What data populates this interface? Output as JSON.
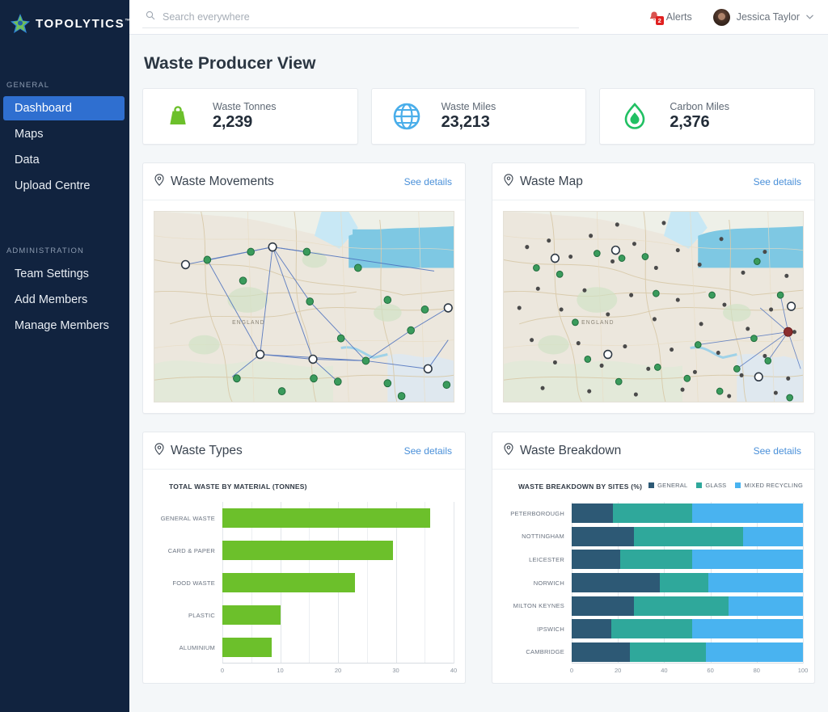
{
  "brand": {
    "name": "TOPOLYTICS",
    "logo_icon": "star-logo-icon"
  },
  "sidebar": {
    "sections": [
      {
        "label": "GENERAL",
        "items": [
          {
            "label": "Dashboard",
            "name": "sidebar-item-dashboard",
            "active": true
          },
          {
            "label": "Maps",
            "name": "sidebar-item-maps",
            "active": false
          },
          {
            "label": "Data",
            "name": "sidebar-item-data",
            "active": false
          },
          {
            "label": "Upload Centre",
            "name": "sidebar-item-upload-centre",
            "active": false
          }
        ]
      },
      {
        "label": "ADMINISTRATION",
        "items": [
          {
            "label": "Team Settings",
            "name": "sidebar-item-team-settings",
            "active": false
          },
          {
            "label": "Add Members",
            "name": "sidebar-item-add-members",
            "active": false
          },
          {
            "label": "Manage Members",
            "name": "sidebar-item-manage-members",
            "active": false
          }
        ]
      }
    ]
  },
  "topbar": {
    "search_placeholder": "Search everywhere",
    "search_value": "",
    "search_icon": "search-icon",
    "alerts_label": "Alerts",
    "alerts_count": "2",
    "alerts_icon": "bell-icon",
    "user_name": "Jessica Taylor",
    "user_caret": "⌄"
  },
  "page": {
    "title": "Waste Producer View"
  },
  "stats": [
    {
      "label": "Waste Tonnes",
      "value": "2,239",
      "icon": "weight-icon",
      "color": "#6cc02b",
      "name": "stat-card-waste-tonnes"
    },
    {
      "label": "Waste Miles",
      "value": "23,213",
      "icon": "globe-icon",
      "color": "#4aaeea",
      "name": "stat-card-waste-miles"
    },
    {
      "label": "Carbon Miles",
      "value": "2,376",
      "icon": "leaf-drop-icon",
      "color": "#21c063",
      "name": "stat-card-carbon-miles"
    }
  ],
  "panels": {
    "waste_movements": {
      "title": "Waste Movements",
      "link": "See details",
      "icon": "map-pin-icon"
    },
    "waste_map": {
      "title": "Waste Map",
      "link": "See details",
      "icon": "map-pin-icon"
    },
    "waste_types": {
      "title": "Waste Types",
      "link": "See details",
      "icon": "map-pin-icon"
    },
    "waste_breakdown": {
      "title": "Waste Breakdown",
      "link": "See details",
      "icon": "map-pin-icon"
    }
  },
  "chart_data": [
    {
      "id": "waste-types",
      "type": "bar",
      "orientation": "horizontal",
      "title": "TOTAL WASTE BY MATERIAL (TONNES)",
      "xlabel": "",
      "ylabel": "",
      "xlim": [
        0,
        40
      ],
      "xticks": [
        0,
        10,
        20,
        30,
        40
      ],
      "xtick_labels": [
        "0",
        "10",
        "20",
        "30",
        "40"
      ],
      "minor_gridlines": [
        5,
        15,
        25,
        35
      ],
      "grid": true,
      "legend": false,
      "bar_color": "#6cc02b",
      "categories": [
        "GENERAL WASTE",
        "CARD & PAPER",
        "FOOD WASTE",
        "PLASTIC",
        "ALUMINIUM"
      ],
      "values": [
        36,
        29.5,
        23,
        10,
        8.5
      ]
    },
    {
      "id": "waste-breakdown",
      "type": "bar",
      "orientation": "horizontal",
      "stacked": true,
      "title": "WASTE BREAKDOWN BY SITES (%)",
      "xlabel": "",
      "ylabel": "",
      "xlim": [
        0,
        100
      ],
      "xticks": [
        0,
        20,
        40,
        60,
        80,
        100
      ],
      "xtick_labels": [
        "0",
        "20",
        "40",
        "60",
        "80",
        "100"
      ],
      "grid": true,
      "legend": true,
      "legend_position": "top-right",
      "categories": [
        "PETERBOROUGH",
        "NOTTINGHAM",
        "LEICESTER",
        "NORWICH",
        "MILTON KEYNES",
        "IPSWICH",
        "CAMBRIDGE"
      ],
      "series": [
        {
          "name": "GENERAL",
          "color": "#2d5975",
          "values": [
            18,
            27,
            21,
            38,
            27,
            17,
            25
          ]
        },
        {
          "name": "GLASS",
          "color": "#2fa89b",
          "values": [
            34,
            47,
            31,
            21,
            41,
            35,
            33
          ]
        },
        {
          "name": "MIXED RECYCLING",
          "color": "#49b3f0",
          "values": [
            48,
            26,
            48,
            41,
            32,
            48,
            42
          ]
        }
      ]
    }
  ],
  "maps": {
    "movements": {
      "region_label": "ENGLAND",
      "marker_icon": "map-marker-dot",
      "name": "waste-movements-map"
    },
    "waste": {
      "region_label": "ENGLAND",
      "marker_icon": "map-marker-dot",
      "name": "waste-map"
    }
  }
}
